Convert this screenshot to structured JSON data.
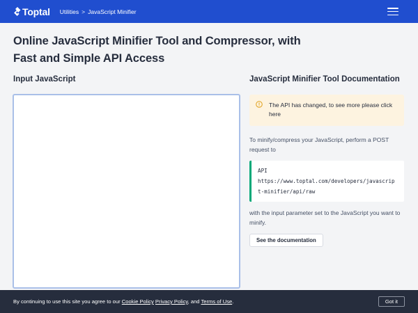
{
  "header": {
    "logo_text": "Toptal",
    "breadcrumb": [
      "Utilities",
      "JavaScript Minifier"
    ],
    "breadcrumb_sep": ">",
    "menu_icon": "hamburger-menu-icon",
    "bg_color": "#204ecf"
  },
  "main": {
    "title": "Online JavaScript Minifier Tool and Compressor, with Fast and Simple API Access",
    "input_label": "Input JavaScript",
    "input_value": ""
  },
  "docs": {
    "title": "JavaScript Minifier Tool Documentation",
    "alert_icon": "warning-icon",
    "alert_text": "The API has changed, to see more please click here",
    "intro": "To minify/compress your JavaScript, perform a POST request to",
    "code_label": "API",
    "code_url": "https://www.toptal.com/developers/javascript-minifier/api/raw",
    "param_text": "with the input parameter set to the JavaScript you want to minify.",
    "button_label": "See the documentation",
    "accent_color": "#00a878"
  },
  "cookie": {
    "prefix": "By continuing to use this site you agree to our",
    "link_cookie": "Cookie Policy",
    "link_privacy": "Privacy Policy",
    "and": ", and",
    "link_terms": "Terms of Use",
    "suffix": ".",
    "button": "Got it"
  }
}
